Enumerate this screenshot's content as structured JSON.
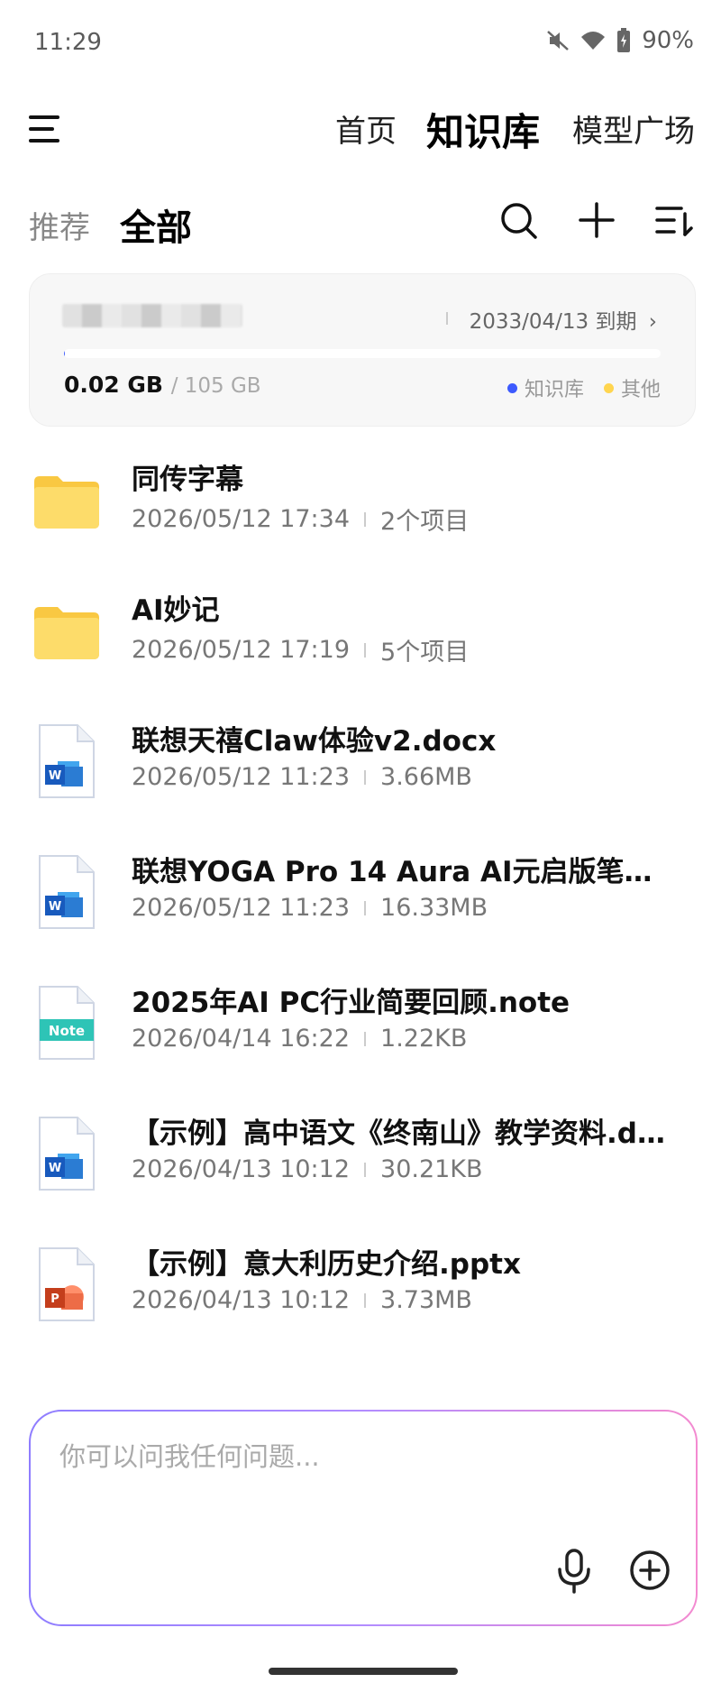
{
  "status_bar": {
    "time": "11:29",
    "battery": "90%"
  },
  "nav": {
    "tabs": [
      "首页",
      "知识库",
      "模型广场"
    ],
    "active": "知识库"
  },
  "sub_tabs": {
    "items": [
      "推荐",
      "全部"
    ],
    "active": "全部"
  },
  "storage": {
    "expiry": "2033/04/13 到期",
    "used": "0.02 GB",
    "total": "/ 105 GB",
    "used_fraction": 0.0002,
    "legend": [
      {
        "label": "知识库",
        "color": "#3d5afe"
      },
      {
        "label": "其他",
        "color": "#ffd54f"
      }
    ]
  },
  "files": [
    {
      "icon": "folder",
      "name": "同传字幕",
      "time": "2026/05/12 17:34",
      "info": "2个项目"
    },
    {
      "icon": "folder",
      "name": "AI妙记",
      "time": "2026/05/12 17:19",
      "info": "5个项目"
    },
    {
      "icon": "word",
      "name": "联想天禧Claw体验v2.docx",
      "time": "2026/05/12 11:23",
      "info": "3.66MB"
    },
    {
      "icon": "word",
      "name": "联想YOGA Pro 14 Aura AI元启版笔记…",
      "time": "2026/05/12 11:23",
      "info": "16.33MB"
    },
    {
      "icon": "note",
      "name": "2025年AI PC行业简要回顾.note",
      "time": "2026/04/14 16:22",
      "info": "1.22KB"
    },
    {
      "icon": "word",
      "name": "【示例】高中语文《终南山》教学资料.d…",
      "time": "2026/04/13 10:12",
      "info": "30.21KB"
    },
    {
      "icon": "ppt",
      "name": "【示例】意大利历史介绍.pptx",
      "time": "2026/04/13 10:12",
      "info": "3.73MB"
    }
  ],
  "ask": {
    "placeholder": "你可以问我任何问题..."
  },
  "colors": {
    "accent": "#3d5afe",
    "folder": "#fdd85d",
    "word": "#2b5fd9",
    "ppt": "#d35230",
    "note": "#2ec4b6"
  }
}
